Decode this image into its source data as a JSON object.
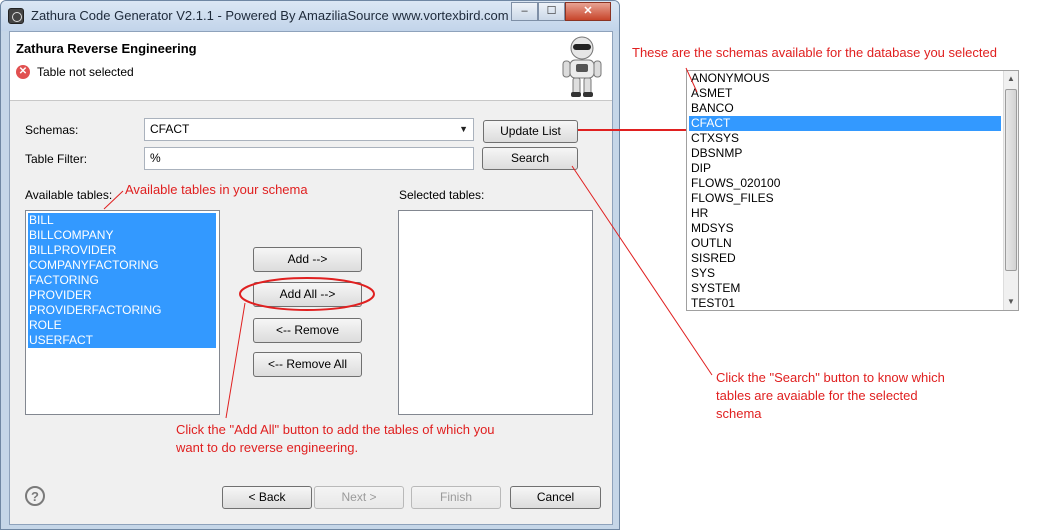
{
  "window": {
    "title": "Zathura Code Generator V2.1.1 - Powered By AmaziliaSource www.vortexbird.com",
    "minimize": "–",
    "maximize": "☐",
    "close": "✕"
  },
  "header": {
    "title": "Zathura Reverse Engineering",
    "message": "Table not selected",
    "error_icon": "✕"
  },
  "form": {
    "schemas_label": "Schemas:",
    "schema_value": "CFACT",
    "table_filter_label": "Table Filter:",
    "table_filter_value": "%",
    "update_list_button": "Update List",
    "search_button": "Search",
    "available_label": "Available tables:",
    "selected_label": "Selected tables:"
  },
  "available_tables": [
    "BILL",
    "BILLCOMPANY",
    "BILLPROVIDER",
    "COMPANYFACTORING",
    "FACTORING",
    "PROVIDER",
    "PROVIDERFACTORING",
    "ROLE",
    "USERFACT"
  ],
  "transfer_buttons": {
    "add": "Add -->",
    "add_all": "Add All -->",
    "remove": "<-- Remove",
    "remove_all": "<-- Remove All"
  },
  "footer": {
    "help": "?",
    "back": "< Back",
    "next": "Next >",
    "finish": "Finish",
    "cancel": "Cancel"
  },
  "schema_list": {
    "items": [
      "ANONYMOUS",
      "ASMET",
      "BANCO",
      "CFACT",
      "CTXSYS",
      "DBSNMP",
      "DIP",
      "FLOWS_020100",
      "FLOWS_FILES",
      "HR",
      "MDSYS",
      "OUTLN",
      "SISRED",
      "SYS",
      "SYSTEM",
      "TEST01"
    ],
    "selected": "CFACT"
  },
  "annotations": {
    "schemas_note": "These are the schemas available for the database you selected",
    "tables_note": "Available tables in your schema",
    "search_note": [
      "Click the \"Search\" button to know which",
      "tables are avaiable for the selected",
      "schema"
    ],
    "add_all_note": [
      "Click the \"Add All\" button to add the tables of which you",
      "want to do reverse engineering."
    ]
  },
  "colors": {
    "selection": "#3399ff",
    "annotation": "#e02020"
  }
}
